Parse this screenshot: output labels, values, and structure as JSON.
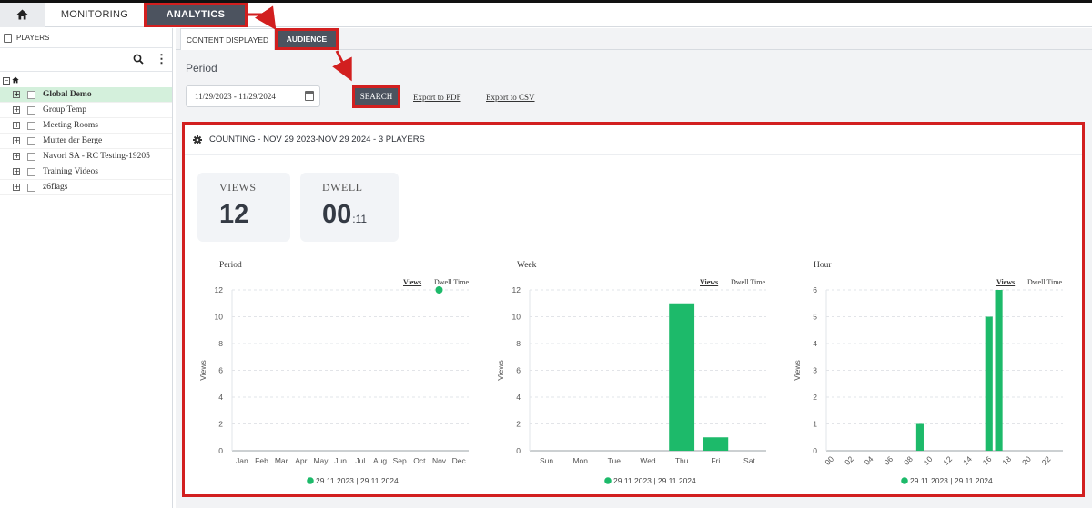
{
  "nav": {
    "home_icon": "home-icon",
    "monitoring": "MONITORING",
    "analytics": "ANALYTICS"
  },
  "sidebar": {
    "header": "PLAYERS",
    "header_icon": "players-icon",
    "search_icon": "search-icon",
    "menu_icon": "kebab-menu-icon",
    "root_icon": "home-icon",
    "items": [
      {
        "label": "Global Demo",
        "selected": true
      },
      {
        "label": "Group Temp"
      },
      {
        "label": "Meeting Rooms"
      },
      {
        "label": "Mutter der Berge"
      },
      {
        "label": "Navori SA - RC Testing-19205"
      },
      {
        "label": "Training Videos"
      },
      {
        "label": "z6flags"
      }
    ]
  },
  "subtabs": {
    "content_displayed": "CONTENT DISPLAYED",
    "audience": "AUDIENCE"
  },
  "filter": {
    "period_label": "Period",
    "date_range": "11/29/2023 - 11/29/2024",
    "search": "SEARCH",
    "export_pdf": "Export to PDF",
    "export_csv": "Export to CSV"
  },
  "panel": {
    "title": "COUNTING - NOV 29 2023-NOV 29 2024 - 3 PLAYERS",
    "views_label": "VIEWS",
    "views_value": "12",
    "dwell_label": "DWELL",
    "dwell_value": "00",
    "dwell_sub": ":11"
  },
  "colors": {
    "accent": "#1dba6a",
    "highlight": "#d21f1f",
    "dark": "#4c535f"
  },
  "chart_data": [
    {
      "type": "scatter",
      "title": "Period",
      "legend": [
        "Views",
        "Dwell Time"
      ],
      "ylabel": "Views",
      "ylim": [
        0,
        12
      ],
      "yticks": [
        0,
        2,
        4,
        6,
        8,
        10,
        12
      ],
      "categories": [
        "Jan",
        "Feb",
        "Mar",
        "Apr",
        "May",
        "Jun",
        "Jul",
        "Aug",
        "Sep",
        "Oct",
        "Nov",
        "Dec"
      ],
      "values": [
        null,
        null,
        null,
        null,
        null,
        null,
        null,
        null,
        null,
        null,
        12,
        null
      ],
      "footer": "29.11.2023 | 29.11.2024"
    },
    {
      "type": "bar",
      "title": "Week",
      "legend": [
        "Views",
        "Dwell Time"
      ],
      "ylabel": "Views",
      "ylim": [
        0,
        12
      ],
      "yticks": [
        0,
        2,
        4,
        6,
        8,
        10,
        12
      ],
      "categories": [
        "Sun",
        "Mon",
        "Tue",
        "Wed",
        "Thu",
        "Fri",
        "Sat"
      ],
      "values": [
        0,
        0,
        0,
        0,
        11,
        1,
        0
      ],
      "footer": "29.11.2023 | 29.11.2024"
    },
    {
      "type": "bar",
      "title": "Hour",
      "legend": [
        "Views",
        "Dwell Time"
      ],
      "ylabel": "Views",
      "ylim": [
        0,
        6
      ],
      "yticks": [
        0,
        1,
        2,
        3,
        4,
        5,
        6
      ],
      "categories": [
        "00",
        "01",
        "02",
        "03",
        "04",
        "05",
        "06",
        "07",
        "08",
        "09",
        "10",
        "11",
        "12",
        "13",
        "14",
        "15",
        "16",
        "17",
        "18",
        "19",
        "20",
        "21",
        "22",
        "23"
      ],
      "tick_labels": [
        "00",
        "02",
        "04",
        "06",
        "08",
        "10",
        "12",
        "14",
        "16",
        "18",
        "20",
        "22"
      ],
      "values": [
        0,
        0,
        0,
        0,
        0,
        0,
        0,
        0,
        0,
        1,
        0,
        0,
        0,
        0,
        0,
        0,
        5,
        6,
        0,
        0,
        0,
        0,
        0,
        0
      ],
      "footer": "29.11.2023 | 29.11.2024"
    }
  ]
}
